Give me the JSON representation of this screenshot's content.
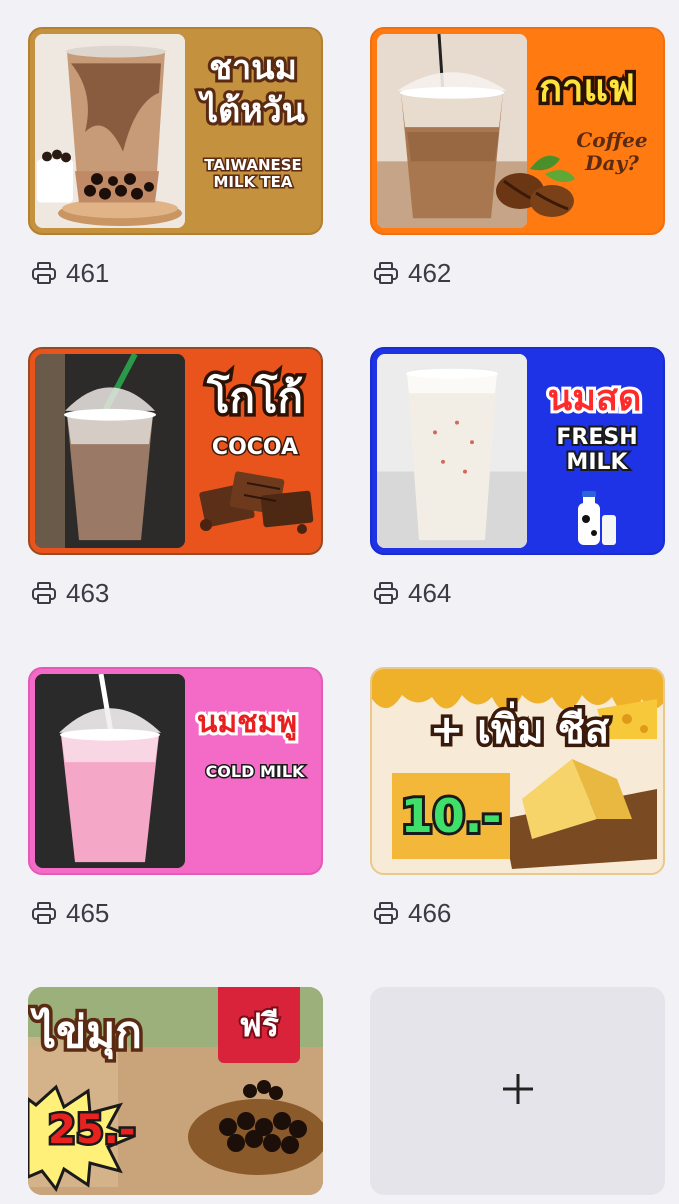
{
  "items": [
    {
      "number": "461",
      "thai": "ชานม\nไต้หวัน",
      "eng": "TAIWANESE\nMILK TEA"
    },
    {
      "number": "462",
      "thai": "กาแฟ",
      "eng": "Coffee\nDay?"
    },
    {
      "number": "463",
      "thai": "โกโก้",
      "eng": "COCOA"
    },
    {
      "number": "464",
      "thai": "นมสด",
      "eng": "FRESH\nMILK"
    },
    {
      "number": "465",
      "thai": "นมชมพู",
      "eng": "COLD MILK"
    },
    {
      "number": "466",
      "thai": "+ เพิ่ม ชีส",
      "price": "10.-"
    },
    {
      "thai": "ไข่มุก",
      "badge": "ฟรี",
      "price": "25.-"
    }
  ],
  "add_button": {
    "symbol": "+"
  },
  "icons": {
    "printer": "printer-icon",
    "add": "plus-icon"
  },
  "colors": {
    "background": "#f1f1f6",
    "card1": "#c4913f",
    "card2": "#ff7a10",
    "card3": "#e8541c",
    "card4": "#1f33e6",
    "card5": "#f46ac7",
    "add_card": "#e4e4ea"
  }
}
